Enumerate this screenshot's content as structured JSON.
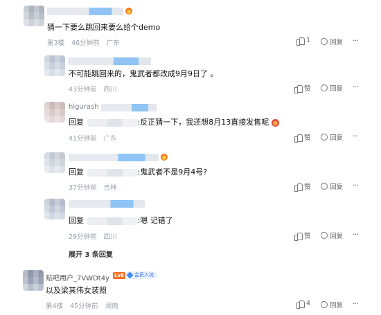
{
  "comments": [
    {
      "text": "猜一下要么跳回来要么给个demo",
      "floor": "第3楼",
      "time": "46分钟前",
      "location": "广东",
      "likes": "1",
      "reply_label": "回复"
    },
    {
      "text": "不可能跳回来的，鬼武者都改成9月9日了 。",
      "time": "43分钟前",
      "location": "四川",
      "likes": "赞",
      "reply_label": "回复"
    },
    {
      "name": "higurash",
      "reply_prefix": "回复",
      "text": ":反正猜一下，我还想8月13直接发售呢",
      "time": "41分钟前",
      "location": "广东",
      "likes": "赞",
      "reply_label": "回复"
    },
    {
      "reply_prefix": "回复",
      "text": ":鬼武者不是9月4号?",
      "time": "37分钟前",
      "location": "吉林",
      "likes": "赞",
      "reply_label": "回复"
    },
    {
      "reply_prefix": "回复",
      "text": ":嗯 记错了",
      "time": "29分钟前",
      "location": "四川",
      "likes": "赞",
      "reply_label": "回复"
    },
    {
      "name": "贴吧用户_7VWDt4y",
      "level": "Lv8",
      "member": "会员入坑",
      "text": "以及梁其伟女装照",
      "floor": "第4楼",
      "time": "45分钟前",
      "location": "湖南",
      "likes": "4",
      "reply_label": "回复"
    }
  ],
  "expand_replies": "展开 3 条回复",
  "icons": [
    "like-icon",
    "reply-icon",
    "more-icon",
    "flame-emoji",
    "angry-emoji",
    "diamond-icon"
  ]
}
